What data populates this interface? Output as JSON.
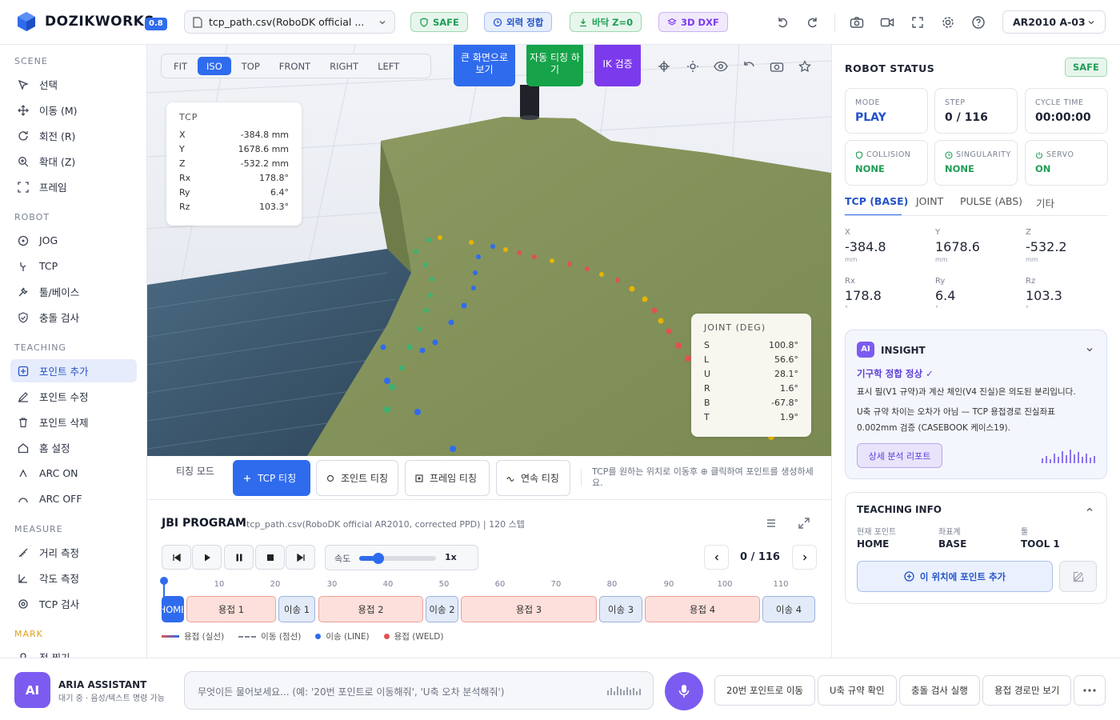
{
  "app": {
    "name": "DOZIKWORKS",
    "version": "0.8"
  },
  "topbar": {
    "file": "tcp_path.csv(RoboDK official ...",
    "chips": [
      "SAFE",
      "외력 정합",
      "바닥 Z=0",
      "3D DXF"
    ],
    "robot": "AR2010 A-03"
  },
  "sidebar": {
    "sections": [
      {
        "title": "SCENE",
        "items": [
          "선택",
          "이동 (M)",
          "회전 (R)",
          "확대 (Z)",
          "프레임"
        ]
      },
      {
        "title": "ROBOT",
        "items": [
          "JOG",
          "TCP",
          "툴/베이스",
          "충돌 검사"
        ]
      },
      {
        "title": "TEACHING",
        "items": [
          "포인트 추가",
          "포인트 수정",
          "포인트 삭제",
          "홈 설정",
          "ARC ON",
          "ARC OFF"
        ]
      },
      {
        "title": "MEASURE",
        "items": [
          "거리 측정",
          "각도 측정",
          "TCP 검사"
        ]
      },
      {
        "title": "MARK",
        "items": [
          "점 찍기"
        ]
      }
    ]
  },
  "viewport": {
    "views": [
      "FIT",
      "ISO",
      "TOP",
      "FRONT",
      "RIGHT",
      "LEFT"
    ],
    "active_view": "ISO",
    "big_buttons": [
      "큰 화면으로 보기",
      "자동 티칭 하기",
      "IK 검증"
    ],
    "tcp": {
      "title": "TCP",
      "rows": [
        {
          "k": "X",
          "v": "-384.8 mm"
        },
        {
          "k": "Y",
          "v": "1678.6 mm"
        },
        {
          "k": "Z",
          "v": "-532.2 mm"
        },
        {
          "k": "Rx",
          "v": "178.8°"
        },
        {
          "k": "Ry",
          "v": "6.4°"
        },
        {
          "k": "Rz",
          "v": "103.3°"
        }
      ]
    },
    "joint": {
      "title": "JOINT (DEG)",
      "rows": [
        {
          "k": "S",
          "v": "100.8°"
        },
        {
          "k": "L",
          "v": "56.6°"
        },
        {
          "k": "U",
          "v": "28.1°"
        },
        {
          "k": "R",
          "v": "1.6°"
        },
        {
          "k": "B",
          "v": "-67.8°"
        },
        {
          "k": "T",
          "v": "1.9°"
        }
      ]
    }
  },
  "teachbar": {
    "mode_label": "티칭 모드",
    "buttons": [
      "TCP 티칭",
      "조인트 티칭",
      "프레임 티칭",
      "연속 티칭"
    ],
    "hint": "TCP를 원하는 위치로 이동후 ⊕ 클릭하여 포인트를 생성하세요."
  },
  "program": {
    "title": "JBI PROGRAM",
    "subtitle": "tcp_path.csv(RoboDK official AR2010, corrected PPD) | 120 스텝",
    "speed_label": "속도",
    "speed_value": "1x",
    "speed_fraction": 0.25,
    "step_display": "0 / 116",
    "ticks": [
      "10",
      "20",
      "30",
      "40",
      "50",
      "60",
      "70",
      "80",
      "90",
      "100",
      "110"
    ],
    "segments": [
      "HOME",
      "용접 1",
      "이송 1",
      "용접 2",
      "이송 2",
      "용접 3",
      "이송 3",
      "용접 4",
      "이송 4"
    ],
    "legend": [
      "용접 (실선)",
      "이동 (점선)",
      "이송 (LINE)",
      "용접 (WELD)"
    ]
  },
  "robot_status": {
    "title": "ROBOT STATUS",
    "badge": "SAFE",
    "cards": [
      {
        "label": "MODE",
        "value": "PLAY"
      },
      {
        "label": "STEP",
        "value": "0 / 116"
      },
      {
        "label": "CYCLE TIME",
        "value": "00:00:00"
      },
      {
        "label": "COLLISION",
        "value": "NONE"
      },
      {
        "label": "SINGULARITY",
        "value": "NONE"
      },
      {
        "label": "SERVO",
        "value": "ON"
      }
    ],
    "tabs": [
      "TCP (BASE)",
      "JOINT",
      "PULSE (ABS)",
      "기타"
    ],
    "coords": [
      {
        "label": "X",
        "value": "-384.8",
        "unit": "mm"
      },
      {
        "label": "Y",
        "value": "1678.6",
        "unit": "mm"
      },
      {
        "label": "Z",
        "value": "-532.2",
        "unit": "mm"
      },
      {
        "label": "Rx",
        "value": "178.8",
        "unit": "°"
      },
      {
        "label": "Ry",
        "value": "6.4",
        "unit": "°"
      },
      {
        "label": "Rz",
        "value": "103.3",
        "unit": "°"
      }
    ]
  },
  "insight": {
    "badge": "AI",
    "title": "INSIGHT",
    "status": "기구학 정합 정상 ✓",
    "text1": "표시 필(V1 규약)과 계산 체인(V4 진실)은 의도된 분리입니다.",
    "text2": "U축 규약 차이는 오차가 아님 — TCP 용접경로 진실좌표 0.002mm 검증 (CASEBOOK 케이스19).",
    "button": "상세 분석 리포트"
  },
  "teaching_info": {
    "title": "TEACHING INFO",
    "labels": [
      "현재 포인트",
      "좌표계",
      "툴"
    ],
    "values": [
      "HOME",
      "BASE",
      "TOOL 1"
    ],
    "button": "이 위치에 포인트 추가"
  },
  "assistant": {
    "avatar": "AI",
    "name": "ARIA ASSISTANT",
    "status": "대기 중 · 음성/텍스트 명령 가능",
    "placeholder": "무엇이든 물어보세요... (예: '20번 포인트로 이동해줘', 'U축 오차 분석해줘')",
    "quick": [
      "20번 포인트로 이동",
      "U축 규약 확인",
      "충돌 검사 실행",
      "용접 경로만 보기"
    ]
  },
  "colors": {
    "accent": "#2f6bed",
    "safe": "#1f9d55",
    "weld": "#e05252",
    "move": "#2f6bed",
    "ik": "#7c3aed",
    "auto": "#16a34a"
  }
}
